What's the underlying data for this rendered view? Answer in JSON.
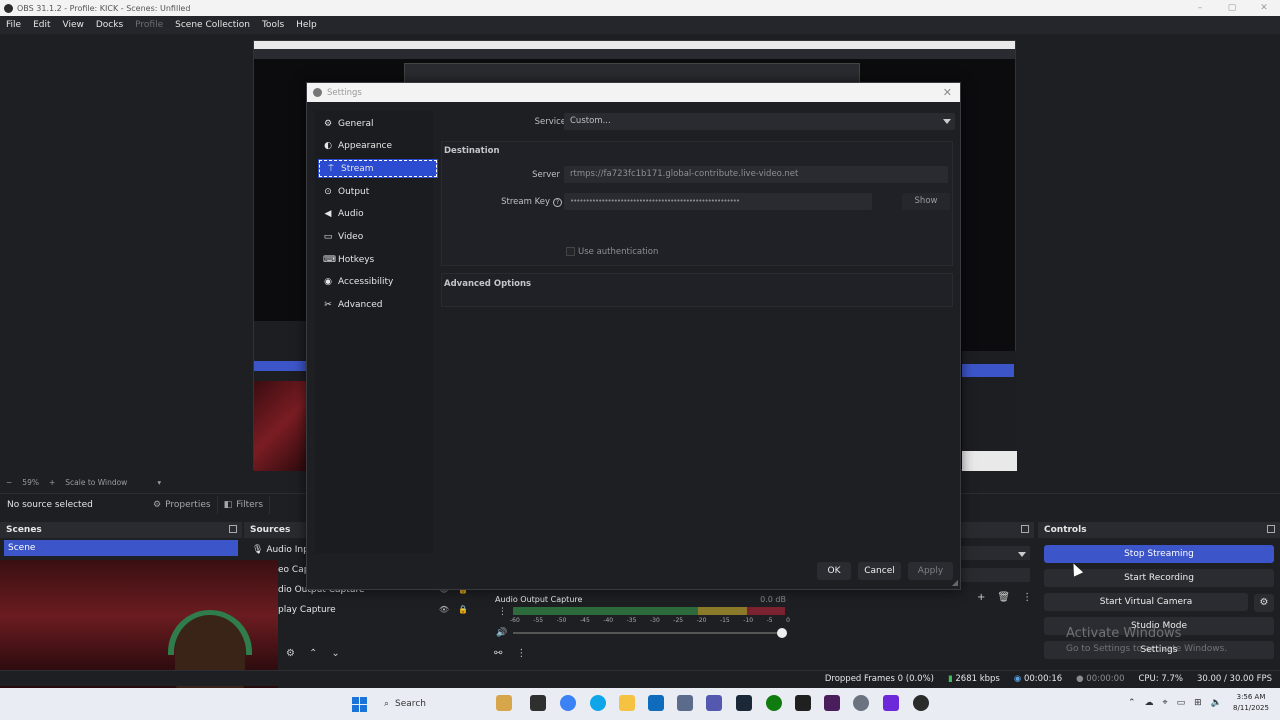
{
  "window": {
    "title": "OBS 31.1.2 - Profile: KICK - Scenes: Unfilled"
  },
  "menu": {
    "file": "File",
    "edit": "Edit",
    "view": "View",
    "docks": "Docks",
    "profile": "Profile",
    "scene_collection": "Scene Collection",
    "tools": "Tools",
    "help": "Help"
  },
  "preview": {
    "zoom": "59%",
    "scale_mode": "Scale to Window"
  },
  "source_bar": {
    "no_source": "No source selected",
    "properties": "Properties",
    "filters": "Filters"
  },
  "scenes": {
    "header": "Scenes",
    "items": [
      "Scene"
    ]
  },
  "sources": {
    "header": "Sources",
    "items": [
      "Audio Input",
      "eo Capture",
      "dio Output Capture",
      "play Capture"
    ]
  },
  "mixer": {
    "source_name": "Audio Output Capture",
    "level": "0.0 dB",
    "ticks": [
      "-60",
      "-55",
      "-50",
      "-45",
      "-40",
      "-35",
      "-30",
      "-25",
      "-20",
      "-15",
      "-10",
      "-5",
      "0"
    ]
  },
  "controls": {
    "header": "Controls",
    "stop_streaming": "Stop Streaming",
    "start_recording": "Start Recording",
    "start_virtual_camera": "Start Virtual Camera",
    "studio_mode": "Studio Mode",
    "settings": "Settings"
  },
  "watermark": {
    "line1": "Activate Windows",
    "line2": "Go to Settings to activate Windows."
  },
  "status": {
    "dropped_frames": "Dropped Frames 0 (0.0%)",
    "bitrate": "2681 kbps",
    "stream_time": "00:00:16",
    "rec_time": "00:00:00",
    "cpu": "CPU: 7.7%",
    "fps": "30.00 / 30.00 FPS"
  },
  "taskbar": {
    "search": "Search",
    "time": "3:56 AM",
    "date": "8/11/2025"
  },
  "settings": {
    "title": "Settings",
    "nav": [
      {
        "label": "General",
        "icon": "gear-icon"
      },
      {
        "label": "Appearance",
        "icon": "palette-icon"
      },
      {
        "label": "Stream",
        "icon": "antenna-icon"
      },
      {
        "label": "Output",
        "icon": "output-icon"
      },
      {
        "label": "Audio",
        "icon": "speaker-icon"
      },
      {
        "label": "Video",
        "icon": "monitor-icon"
      },
      {
        "label": "Hotkeys",
        "icon": "keyboard-icon"
      },
      {
        "label": "Accessibility",
        "icon": "accessibility-icon"
      },
      {
        "label": "Advanced",
        "icon": "tools-icon"
      }
    ],
    "active_nav": "Stream",
    "service_label": "Service",
    "service_value": "Custom...",
    "destination_title": "Destination",
    "server_label": "Server",
    "server_value": "rtmps://fa723fc1b171.global-contribute.live-video.net",
    "stream_key_label": "Stream Key",
    "stream_key_value": "••••••••••••••••••••••••••••••••••••••••••••••••••••••",
    "show_button": "Show",
    "use_auth": "Use authentication",
    "advanced_title": "Advanced Options",
    "ok": "OK",
    "cancel": "Cancel",
    "apply": "Apply"
  }
}
